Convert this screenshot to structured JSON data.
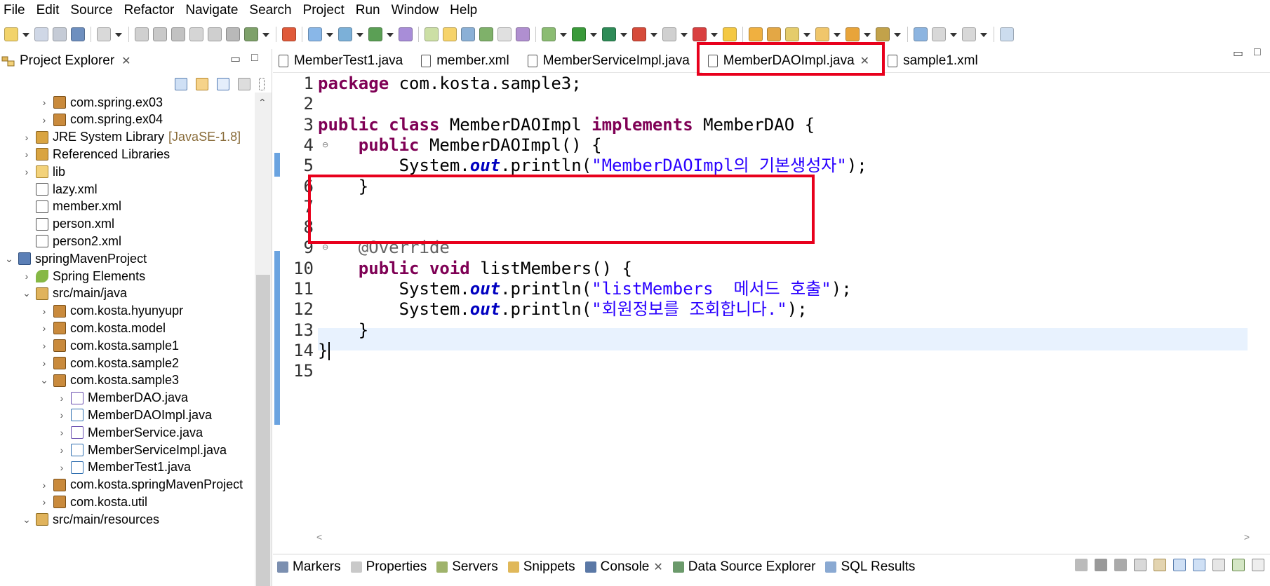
{
  "menubar": [
    "File",
    "Edit",
    "Source",
    "Refactor",
    "Navigate",
    "Search",
    "Project",
    "Run",
    "Window",
    "Help"
  ],
  "explorer": {
    "title": "Project Explorer",
    "close_glyph": "✕",
    "minimize_glyph": "▭",
    "maximize_glyph": "□",
    "scroll_up_glyph": "⌃",
    "items": [
      {
        "label": "com.spring.ex03",
        "depth": 2,
        "twisty": "›",
        "icon": "package-icon",
        "decor": ""
      },
      {
        "label": "com.spring.ex04",
        "depth": 2,
        "twisty": "›",
        "icon": "package-icon",
        "decor": ""
      },
      {
        "label": "JRE System Library",
        "depth": 1,
        "twisty": "›",
        "icon": "library-icon",
        "decor": "[JavaSE-1.8]"
      },
      {
        "label": "Referenced Libraries",
        "depth": 1,
        "twisty": "›",
        "icon": "library-icon",
        "decor": ""
      },
      {
        "label": "lib",
        "depth": 1,
        "twisty": "›",
        "icon": "folder-icon",
        "decor": ""
      },
      {
        "label": "lazy.xml",
        "depth": 1,
        "twisty": "",
        "icon": "xml-file-icon",
        "decor": ""
      },
      {
        "label": "member.xml",
        "depth": 1,
        "twisty": "",
        "icon": "xml-file-icon",
        "decor": ""
      },
      {
        "label": "person.xml",
        "depth": 1,
        "twisty": "",
        "icon": "xml-file-icon",
        "decor": ""
      },
      {
        "label": "person2.xml",
        "depth": 1,
        "twisty": "",
        "icon": "xml-file-icon",
        "decor": ""
      },
      {
        "label": "springMavenProject",
        "depth": 0,
        "twisty": "⌄",
        "icon": "maven-project-icon",
        "decor": ""
      },
      {
        "label": "Spring Elements",
        "depth": 1,
        "twisty": "›",
        "icon": "spring-leaf-icon",
        "decor": ""
      },
      {
        "label": "src/main/java",
        "depth": 1,
        "twisty": "⌄",
        "icon": "source-folder-icon",
        "decor": ""
      },
      {
        "label": "com.kosta.hyunyupr",
        "depth": 2,
        "twisty": "›",
        "icon": "package-icon",
        "decor": ""
      },
      {
        "label": "com.kosta.model",
        "depth": 2,
        "twisty": "›",
        "icon": "package-icon",
        "decor": ""
      },
      {
        "label": "com.kosta.sample1",
        "depth": 2,
        "twisty": "›",
        "icon": "package-icon",
        "decor": ""
      },
      {
        "label": "com.kosta.sample2",
        "depth": 2,
        "twisty": "›",
        "icon": "package-icon",
        "decor": ""
      },
      {
        "label": "com.kosta.sample3",
        "depth": 2,
        "twisty": "⌄",
        "icon": "package-icon",
        "decor": ""
      },
      {
        "label": "MemberDAO.java",
        "depth": 3,
        "twisty": "›",
        "icon": "java-interface-icon",
        "decor": ""
      },
      {
        "label": "MemberDAOImpl.java",
        "depth": 3,
        "twisty": "›",
        "icon": "java-class-icon",
        "decor": ""
      },
      {
        "label": "MemberService.java",
        "depth": 3,
        "twisty": "›",
        "icon": "java-interface-icon",
        "decor": ""
      },
      {
        "label": "MemberServiceImpl.java",
        "depth": 3,
        "twisty": "›",
        "icon": "java-class-icon",
        "decor": ""
      },
      {
        "label": "MemberTest1.java",
        "depth": 3,
        "twisty": "›",
        "icon": "java-class-icon",
        "decor": ""
      },
      {
        "label": "com.kosta.springMavenProject",
        "depth": 2,
        "twisty": "›",
        "icon": "package-icon",
        "decor": ""
      },
      {
        "label": "com.kosta.util",
        "depth": 2,
        "twisty": "›",
        "icon": "package-icon",
        "decor": ""
      },
      {
        "label": "src/main/resources",
        "depth": 1,
        "twisty": "⌄",
        "icon": "source-folder-icon",
        "decor": ""
      }
    ]
  },
  "editor": {
    "tabs": [
      {
        "label": "MemberTest1.java",
        "icon": "java-file-icon",
        "active": false
      },
      {
        "label": "member.xml",
        "icon": "xml-file-icon",
        "active": false
      },
      {
        "label": "MemberServiceImpl.java",
        "icon": "java-file-icon",
        "active": false
      },
      {
        "label": "MemberDAOImpl.java",
        "icon": "java-file-icon",
        "active": true
      },
      {
        "label": "sample1.xml",
        "icon": "xml-file-icon",
        "active": false
      }
    ],
    "active_close_glyph": "✕",
    "line_numbers": [
      "1",
      "2",
      "3",
      "4",
      "5",
      "6",
      "7",
      "8",
      "9",
      "10",
      "11",
      "12",
      "13",
      "14",
      "15"
    ],
    "current_line": 14,
    "scroll_left_glyph": "<",
    "scroll_right_glyph": ">",
    "code": [
      [
        {
          "t": "package",
          "c": "kw"
        },
        {
          "t": " com.kosta.sample3;",
          "c": ""
        }
      ],
      [],
      [
        {
          "t": "public",
          "c": "kw"
        },
        {
          "t": " ",
          "c": ""
        },
        {
          "t": "class",
          "c": "kw"
        },
        {
          "t": " MemberDAOImpl ",
          "c": ""
        },
        {
          "t": "implements",
          "c": "kw"
        },
        {
          "t": " MemberDAO {",
          "c": ""
        }
      ],
      [
        {
          "t": "    ",
          "c": ""
        },
        {
          "t": "public",
          "c": "kw"
        },
        {
          "t": " MemberDAOImpl() {",
          "c": ""
        }
      ],
      [
        {
          "t": "        System.",
          "c": ""
        },
        {
          "t": "out",
          "c": "fld"
        },
        {
          "t": ".println(",
          "c": ""
        },
        {
          "t": "\"MemberDAOImpl의 기본생성자\"",
          "c": "str"
        },
        {
          "t": ");",
          "c": ""
        }
      ],
      [
        {
          "t": "    }",
          "c": ""
        }
      ],
      [],
      [],
      [
        {
          "t": "    ",
          "c": ""
        },
        {
          "t": "@Override",
          "c": "ann"
        }
      ],
      [
        {
          "t": "    ",
          "c": ""
        },
        {
          "t": "public",
          "c": "kw"
        },
        {
          "t": " ",
          "c": ""
        },
        {
          "t": "void",
          "c": "kw"
        },
        {
          "t": " listMembers() {",
          "c": ""
        }
      ],
      [
        {
          "t": "        System.",
          "c": ""
        },
        {
          "t": "out",
          "c": "fld"
        },
        {
          "t": ".println(",
          "c": ""
        },
        {
          "t": "\"listMembers  메서드 호출\"",
          "c": "str"
        },
        {
          "t": ");",
          "c": ""
        }
      ],
      [
        {
          "t": "        System.",
          "c": ""
        },
        {
          "t": "out",
          "c": "fld"
        },
        {
          "t": ".println(",
          "c": ""
        },
        {
          "t": "\"회원정보를 조회합니다.\"",
          "c": "str"
        },
        {
          "t": ");",
          "c": ""
        }
      ],
      [
        {
          "t": "    }",
          "c": ""
        }
      ],
      [
        {
          "t": "}",
          "c": ""
        }
      ],
      []
    ]
  },
  "bottom_panel": {
    "tabs": [
      {
        "label": "Markers",
        "icon": "markers-icon"
      },
      {
        "label": "Properties",
        "icon": "properties-icon"
      },
      {
        "label": "Servers",
        "icon": "servers-icon"
      },
      {
        "label": "Snippets",
        "icon": "snippets-icon"
      },
      {
        "label": "Console",
        "icon": "console-icon",
        "active": true,
        "close": "✕"
      },
      {
        "label": "Data Source Explorer",
        "icon": "data-source-icon"
      },
      {
        "label": "SQL Results",
        "icon": "sql-results-icon"
      }
    ]
  },
  "colors": {
    "keyword": "#7f0055",
    "string": "#2a00ff",
    "field": "#0000c0",
    "annotation": "#646464",
    "highlight_box": "#e8001c",
    "current_line": "#e8f2fe"
  }
}
